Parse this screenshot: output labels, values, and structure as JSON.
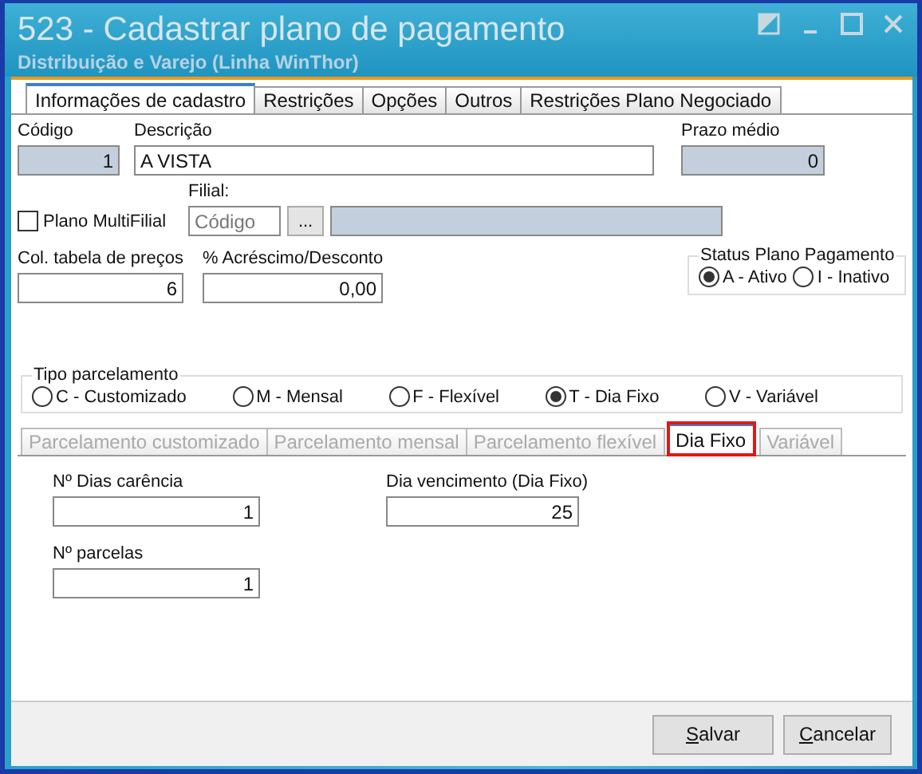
{
  "window": {
    "title": "523 - Cadastrar plano de pagamento",
    "subtitle": "Distribuição e Varejo (Linha WinThor)"
  },
  "tabs": [
    {
      "label": "Informações de cadastro",
      "selected": true
    },
    {
      "label": "Restrições",
      "selected": false
    },
    {
      "label": "Opções",
      "selected": false
    },
    {
      "label": "Outros",
      "selected": false
    },
    {
      "label": "Restrições Plano Negociado",
      "selected": false
    }
  ],
  "codigo": {
    "label": "Código",
    "value": "1"
  },
  "descricao": {
    "label": "Descrição",
    "value": "A VISTA"
  },
  "prazo_medio": {
    "label": "Prazo médio",
    "value": "0"
  },
  "multifilial": {
    "label": "Plano MultiFilial",
    "checked": false
  },
  "filial": {
    "label": "Filial:",
    "placeholder": "Código",
    "browse": "..."
  },
  "col_tabela": {
    "label": "Col. tabela de preços",
    "value": "6"
  },
  "acrescimo": {
    "label": "% Acréscimo/Desconto",
    "value": "0,00"
  },
  "status": {
    "title": "Status Plano Pagamento",
    "options": [
      {
        "label": "A - Ativo",
        "selected": true
      },
      {
        "label": "I - Inativo",
        "selected": false
      }
    ]
  },
  "tipo_parcelamento": {
    "title": "Tipo parcelamento",
    "options": [
      {
        "label": "C - Customizado",
        "selected": false
      },
      {
        "label": "M - Mensal",
        "selected": false
      },
      {
        "label": "F - Flexível",
        "selected": false
      },
      {
        "label": "T - Dia Fixo",
        "selected": true
      },
      {
        "label": "V - Variável",
        "selected": false
      }
    ]
  },
  "subtabs": [
    {
      "label": "Parcelamento customizado",
      "selected": false,
      "disabled": true,
      "highlighted": false
    },
    {
      "label": "Parcelamento mensal",
      "selected": false,
      "disabled": true,
      "highlighted": false
    },
    {
      "label": "Parcelamento flexível",
      "selected": false,
      "disabled": true,
      "highlighted": false
    },
    {
      "label": "Dia Fixo",
      "selected": true,
      "disabled": false,
      "highlighted": true
    },
    {
      "label": "Variável",
      "selected": false,
      "disabled": true,
      "highlighted": false
    }
  ],
  "dias_carencia": {
    "label": "Nº Dias carência",
    "value": "1"
  },
  "dia_vencimento": {
    "label": "Dia vencimento (Dia Fixo)",
    "value": "25"
  },
  "parcelas": {
    "label": "Nº parcelas",
    "value": "1"
  },
  "buttons": [
    "Salvar",
    "Cancelar"
  ]
}
